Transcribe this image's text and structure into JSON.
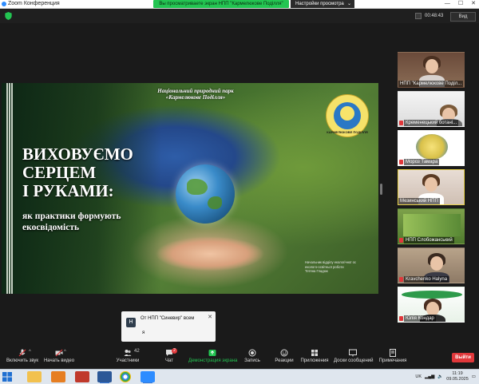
{
  "window": {
    "app_title": "Zoom Конференция",
    "sharing_banner": "Вы просматриваете экран НПП \"Кармелюкове Поділля\"",
    "view_options": "Настройки просмотра",
    "timer": "00:48:43",
    "view_button": "Вид"
  },
  "slide": {
    "park_title_line1": "Національний природний парк",
    "park_title_line2": "«Кармелюкове Поділля»",
    "headline": [
      "ВИХОВУЄМО",
      "СЕРЦЕМ",
      "І РУКАМИ:"
    ],
    "subline": [
      "як практики формують",
      "екосвідомість"
    ],
    "logo_text": "КАРМЕЛЮКОВЕ ПОДІЛЛЯ",
    "credits": [
      "Начальник відділу екологічної ос",
      "еколого-освітньої роботи",
      "Тетяна Гладюк"
    ]
  },
  "participants": [
    {
      "name": "НПП \"Кармелюкове Поділ...",
      "muted": false
    },
    {
      "name": "Кременецький ботані...",
      "muted": true
    },
    {
      "name": "Мороз Тамара",
      "muted": true
    },
    {
      "name": "Мезинський НПП",
      "muted": false,
      "active": true
    },
    {
      "name": "НПП Слобожанський",
      "muted": true
    },
    {
      "name": "Kravchenko Halyna",
      "muted": true
    },
    {
      "name": "Юлія Кондар",
      "muted": true
    }
  ],
  "chat_popup": {
    "avatar": "Н",
    "from": "От НПП \"Синевир\"  всем",
    "message": "я"
  },
  "toolbar": {
    "mute": "Включить звук",
    "video": "Начать видео",
    "participants": "Участники",
    "participants_count": "42",
    "chat": "Чат",
    "chat_badge": "2",
    "share": "Демонстрация экрана",
    "record": "Запись",
    "reactions": "Реакции",
    "apps": "Приложения",
    "whiteboards": "Доски сообщений",
    "notes": "Примечания",
    "leave": "Выйти"
  },
  "taskbar": {
    "lang": "UK",
    "time": "11:19",
    "date": "09.05.2025"
  },
  "colors": {
    "share_green": "#23c552",
    "leave_red": "#e0383b",
    "active_tile": "#e8d24a"
  }
}
